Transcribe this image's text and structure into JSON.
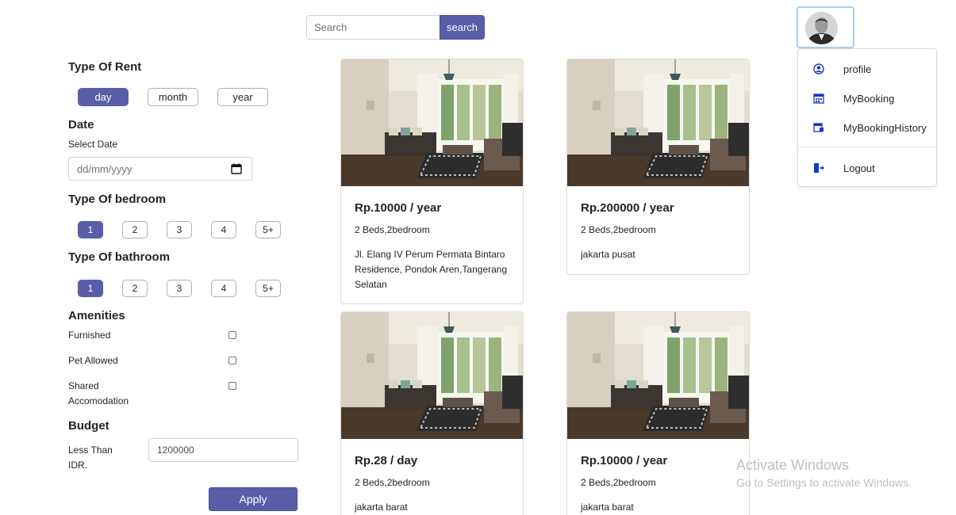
{
  "search": {
    "placeholder": "Search",
    "button_label": "search"
  },
  "user_menu": {
    "items": [
      {
        "label": "profile",
        "icon": "user-circle-icon"
      },
      {
        "label": "MyBooking",
        "icon": "calendar-icon"
      },
      {
        "label": "MyBookingHistory",
        "icon": "history-icon"
      },
      {
        "label": "Logout",
        "icon": "logout-icon"
      }
    ]
  },
  "filters": {
    "rent": {
      "heading": "Type Of Rent",
      "options": [
        "day",
        "month",
        "year"
      ],
      "selected": "day"
    },
    "date": {
      "heading": "Date",
      "label": "Select Date",
      "placeholder": "dd/mm/yyyy"
    },
    "bedroom": {
      "heading": "Type Of bedroom",
      "options": [
        "1",
        "2",
        "3",
        "4",
        "5+"
      ],
      "selected": "1"
    },
    "bathroom": {
      "heading": "Type Of bathroom",
      "options": [
        "1",
        "2",
        "3",
        "4",
        "5+"
      ],
      "selected": "1"
    },
    "amenities": {
      "heading": "Amenities",
      "items": [
        "Furnished",
        "Pet Allowed",
        "Shared Accomodation"
      ]
    },
    "budget": {
      "heading": "Budget",
      "label": "Less Than IDR.",
      "value": "1200000"
    },
    "apply_label": "Apply"
  },
  "listings": [
    {
      "price": "Rp.10000 / year",
      "beds": "2 Beds,2bedroom",
      "address": "Jl. Elang IV Perum Permata Bintaro Residence, Pondok Aren,Tangerang Selatan"
    },
    {
      "price": "Rp.200000 / year",
      "beds": "2 Beds,2bedroom",
      "address": "jakarta pusat"
    },
    {
      "price": "Rp.28 / day",
      "beds": "2 Beds,2bedroom",
      "address": "jakarta barat"
    },
    {
      "price": "Rp.10000 / year",
      "beds": "2 Beds,2bedroom",
      "address": "jakarta barat"
    }
  ],
  "watermark": {
    "title": "Activate Windows",
    "subtitle": "Go to Settings to activate Windows."
  },
  "colors": {
    "accent": "#5a5ea8",
    "menu_icon": "#1b36c7"
  }
}
